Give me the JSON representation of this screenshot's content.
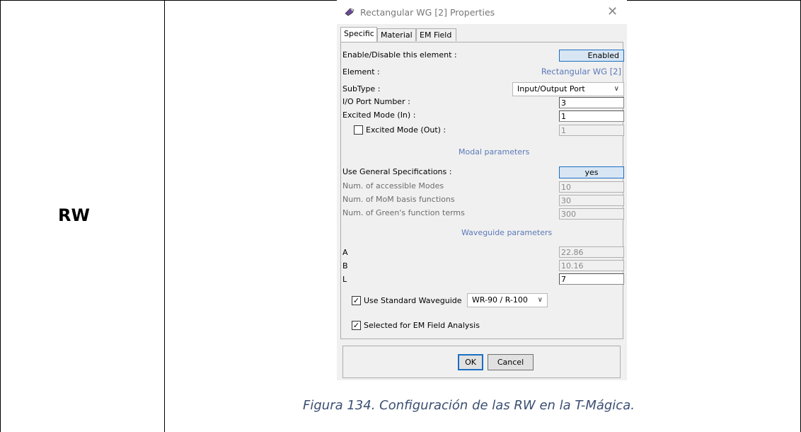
{
  "table": {
    "row_label": "RW",
    "caption": "Figura 134. Configuración de las RW en la T-Mágica."
  },
  "dialog": {
    "title": "Rectangular WG [2] Properties",
    "title_icon": "app-icon",
    "close_icon": "close-icon",
    "tabs": [
      "Specific",
      "Material",
      "EM Field"
    ],
    "active_tab": "Specific",
    "enable_label": "Enable/Disable this element :",
    "enable_value": "Enabled",
    "element_label": "Element :",
    "element_value": "Rectangular WG [2]",
    "subtype_label": "SubType :",
    "subtype_value": "Input/Output Port",
    "io_port_label": "I/O Port Number :",
    "io_port_value": "3",
    "excited_in_label": "Excited Mode (In) :",
    "excited_in_value": "1",
    "excited_out_label": "Excited Mode (Out) :",
    "excited_out_value": "1",
    "excited_out_checked": false,
    "modal_section": "Modal parameters",
    "general_spec_label": "Use General Specifications :",
    "general_spec_value": "yes",
    "accessible_modes_label": "Num. of accessible Modes",
    "accessible_modes_value": "10",
    "mom_basis_label": "Num. of MoM basis functions",
    "mom_basis_value": "30",
    "green_terms_label": "Num. of Green's function terms",
    "green_terms_value": "300",
    "waveguide_section": "Waveguide parameters",
    "a_label": "A",
    "a_value": "22.86",
    "b_label": "B",
    "b_value": "10.16",
    "l_label": "L",
    "l_value": "7",
    "std_wg_label": "Use Standard Waveguide",
    "std_wg_checked": true,
    "std_wg_value": "WR-90 / R-100",
    "em_analysis_label": "Selected for EM Field Analysis",
    "em_analysis_checked": true,
    "ok_label": "OK",
    "cancel_label": "Cancel",
    "check_glyph": "✓",
    "chevron_glyph": "∨"
  },
  "colors": {
    "section_blue": "#5a79b9",
    "caption_blue": "#3b4f72",
    "button_blue_fill": "#d8e6f4",
    "button_blue_border": "#1b6fc2"
  }
}
